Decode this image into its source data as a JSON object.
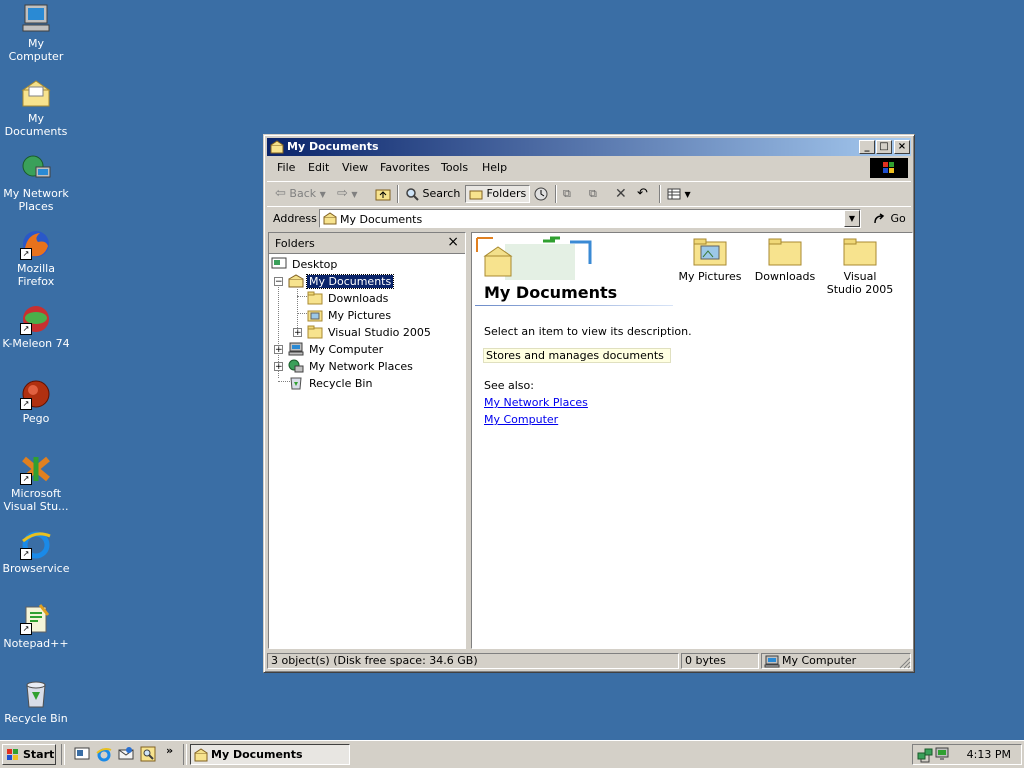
{
  "desktop": {
    "icons": [
      {
        "label": "My Computer",
        "icon": "my-computer-icon"
      },
      {
        "label": "My Documents",
        "icon": "my-documents-icon"
      },
      {
        "label": "My Network Places",
        "icon": "network-places-icon"
      },
      {
        "label": "Mozilla Firefox",
        "icon": "firefox-icon"
      },
      {
        "label": "K-Meleon 74",
        "icon": "k-meleon-icon"
      },
      {
        "label": "Pego",
        "icon": "pego-icon"
      },
      {
        "label": "Microsoft Visual Stu...",
        "icon": "visual-studio-icon"
      },
      {
        "label": "Browservice",
        "icon": "browservice-icon"
      },
      {
        "label": "Notepad++",
        "icon": "notepad-plus-plus-icon"
      },
      {
        "label": "Recycle Bin",
        "icon": "recycle-bin-icon"
      }
    ]
  },
  "window": {
    "title": "My Documents",
    "controls": {
      "minimize": "_",
      "maximize": "□",
      "close": "×"
    }
  },
  "menubar": {
    "items": [
      "File",
      "Edit",
      "View",
      "Favorites",
      "Tools",
      "Help"
    ]
  },
  "toolbar": {
    "back": "Back",
    "search": "Search",
    "folders": "Folders"
  },
  "address": {
    "label": "Address",
    "value": "My Documents",
    "go": "Go"
  },
  "folders_pane": {
    "title": "Folders",
    "close": "×",
    "tree": [
      {
        "label": "Desktop",
        "icon": "desktop-icon"
      },
      {
        "label": "My Documents",
        "icon": "my-documents-icon",
        "selected": true
      },
      {
        "label": "Downloads",
        "icon": "folder-icon"
      },
      {
        "label": "My Pictures",
        "icon": "pictures-folder-icon"
      },
      {
        "label": "Visual Studio 2005",
        "icon": "folder-icon"
      },
      {
        "label": "My Computer",
        "icon": "my-computer-icon"
      },
      {
        "label": "My Network Places",
        "icon": "network-places-icon"
      },
      {
        "label": "Recycle Bin",
        "icon": "recycle-bin-icon"
      }
    ]
  },
  "content": {
    "title": "My Documents",
    "select_prompt": "Select an item to view its description.",
    "description": "Stores and manages documents",
    "see_also": "See also:",
    "links": [
      "My Network Places",
      "My Computer"
    ],
    "items": [
      {
        "label": "My Pictures",
        "icon": "pictures-folder-icon"
      },
      {
        "label": "Downloads",
        "icon": "folder-icon"
      },
      {
        "label": "Visual Studio 2005",
        "icon": "folder-icon"
      }
    ]
  },
  "statusbar": {
    "objects": "3 object(s) (Disk free space: 34.6 GB)",
    "size": "0 bytes",
    "zone": "My Computer"
  },
  "taskbar": {
    "start": "Start",
    "task": "My Documents",
    "clock": "4:13 PM"
  },
  "colors": {
    "desktop": "#3a6ea5",
    "title_active": "#0a246a",
    "selection": "#0a246a",
    "link": "#0000ee"
  }
}
